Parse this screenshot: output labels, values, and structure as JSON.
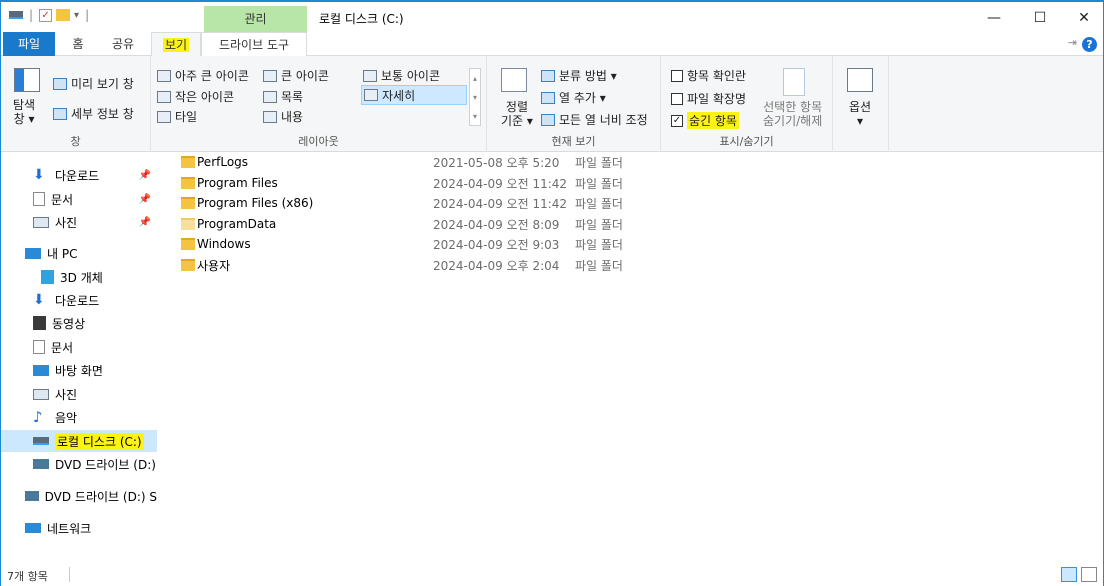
{
  "titlebar": {
    "title": "로컬 디스크 (C:)",
    "contextual_tab": "관리",
    "minimize": "—",
    "maximize": "☐",
    "close": "✕"
  },
  "tabs": {
    "file": "파일",
    "home": "홈",
    "share": "공유",
    "view": "보기",
    "drive_tools": "드라이브 도구"
  },
  "ribbon": {
    "pane": {
      "nav_pane": "탐색\n창",
      "nav_pane_line1": "탐색",
      "nav_pane_line2": "창 ▾",
      "preview": "미리 보기 창",
      "details": "세부 정보 창",
      "label": "창"
    },
    "layout": {
      "extra_large": "아주 큰 아이콘",
      "large": "큰 아이콘",
      "medium": "보통 아이콘",
      "small": "작은 아이콘",
      "list": "목록",
      "details": "자세히",
      "tiles": "타일",
      "content": "내용",
      "label": "레이아웃"
    },
    "current_view": {
      "sort_line1": "정렬",
      "sort_line2": "기준 ▾",
      "group_by": "분류 방법 ▾",
      "add_columns": "열 추가 ▾",
      "size_all": "모든 열 너비 조정",
      "label": "현재 보기"
    },
    "show_hide": {
      "item_checkboxes": "항목 확인란",
      "file_extensions": "파일 확장명",
      "hidden_items": "숨긴 항목",
      "hide_selected_line1": "선택한 항목",
      "hide_selected_line2": "숨기기/해제",
      "label": "표시/숨기기"
    },
    "options": {
      "label": "옵션",
      "arrow": "▾"
    }
  },
  "nav": {
    "items": [
      {
        "label": "다운로드",
        "icon": "download-icon"
      },
      {
        "label": "문서",
        "icon": "document-icon"
      },
      {
        "label": "사진",
        "icon": "pictures-icon"
      },
      {
        "label": "내 PC",
        "icon": "pc-icon"
      },
      {
        "label": "3D 개체",
        "icon": "3d-icon"
      },
      {
        "label": "다운로드",
        "icon": "download-icon"
      },
      {
        "label": "동영상",
        "icon": "video-icon"
      },
      {
        "label": "문서",
        "icon": "document-icon"
      },
      {
        "label": "바탕 화면",
        "icon": "desktop-icon"
      },
      {
        "label": "사진",
        "icon": "pictures-icon"
      },
      {
        "label": "음악",
        "icon": "music-icon"
      },
      {
        "label": "로컬 디스크 (C:)",
        "icon": "drive-icon"
      },
      {
        "label": "DVD 드라이브 (D:)",
        "icon": "dvd-icon"
      },
      {
        "label": "DVD 드라이브 (D:) S",
        "icon": "dvd-icon"
      },
      {
        "label": "네트워크",
        "icon": "network-icon"
      }
    ]
  },
  "files": [
    {
      "name": "PerfLogs",
      "date": "2021-05-08 오후 5:20",
      "type": "파일 폴더"
    },
    {
      "name": "Program Files",
      "date": "2024-04-09 오전 11:42",
      "type": "파일 폴더"
    },
    {
      "name": "Program Files (x86)",
      "date": "2024-04-09 오전 11:42",
      "type": "파일 폴더"
    },
    {
      "name": "ProgramData",
      "date": "2024-04-09 오전 8:09",
      "type": "파일 폴더"
    },
    {
      "name": "Windows",
      "date": "2024-04-09 오전 9:03",
      "type": "파일 폴더"
    },
    {
      "name": "사용자",
      "date": "2024-04-09 오후 2:04",
      "type": "파일 폴더"
    }
  ],
  "status": {
    "item_count": "7개 항목"
  }
}
